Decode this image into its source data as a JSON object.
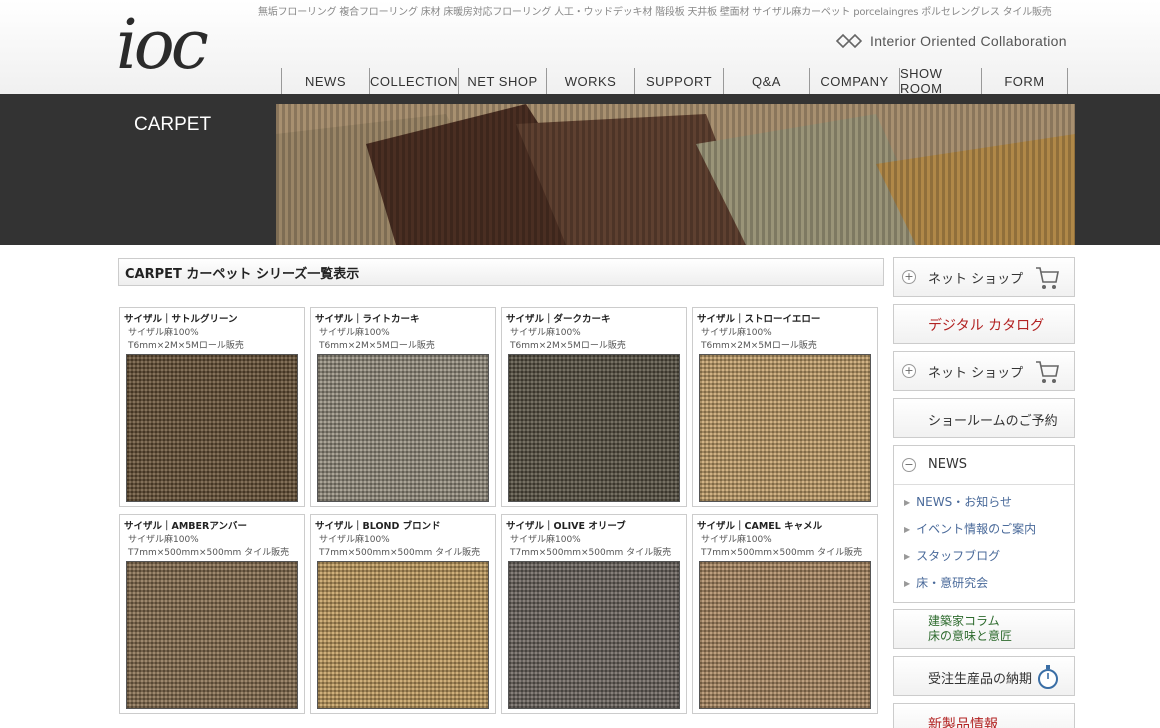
{
  "header": {
    "logo": "ioc",
    "keywords": "無垢フローリング 複合フローリング 床材 床暖房対応フローリング 人工・ウッドデッキ材 階段板 天井板 壁面材 サイザル麻カーペット porcelaingres ポルセレングレス タイル販売",
    "tagline": "Interior Oriented Collaboration"
  },
  "nav": [
    {
      "label": "NEWS",
      "w": 88
    },
    {
      "label": "COLLECTION",
      "w": 89
    },
    {
      "label": "NET SHOP",
      "w": 88
    },
    {
      "label": "WORKS",
      "w": 88
    },
    {
      "label": "SUPPORT",
      "w": 89
    },
    {
      "label": "Q&A",
      "w": 86
    },
    {
      "label": "COMPANY",
      "w": 90
    },
    {
      "label": "SHOW ROOM",
      "w": 82
    },
    {
      "label": "FORM",
      "w": 87
    }
  ],
  "banner": {
    "title": "CARPET"
  },
  "section_title": "CARPET カーペット シリーズ一覧表示",
  "products": [
    {
      "title": "サイザル｜サトルグリーン",
      "material": "サイザル麻100%",
      "spec": "T6mm×2M×5Mロール販売",
      "color": "#6b5438"
    },
    {
      "title": "サイザル｜ライトカーキ",
      "material": "サイザル麻100%",
      "spec": "T6mm×2M×5Mロール販売",
      "color": "#9a9282"
    },
    {
      "title": "サイザル｜ダークカーキ",
      "material": "サイザル麻100%",
      "spec": "T6mm×2M×5Mロール販売",
      "color": "#5a5444"
    },
    {
      "title": "サイザル｜ストローイエロー",
      "material": "サイザル麻100%",
      "spec": "T6mm×2M×5Mロール販売",
      "color": "#c8a46c"
    },
    {
      "title": "サイザル｜AMBERアンバー",
      "material": "サイザル麻100%",
      "spec": "T7mm×500mm×500mm タイル販売",
      "color": "#8a7050"
    },
    {
      "title": "サイザル｜BLOND ブロンド",
      "material": "サイザル麻100%",
      "spec": "T7mm×500mm×500mm タイル販売",
      "color": "#c6a060"
    },
    {
      "title": "サイザル｜OLIVE オリーブ",
      "material": "サイザル麻100%",
      "spec": "T7mm×500mm×500mm タイル販売",
      "color": "#6e6660"
    },
    {
      "title": "サイザル｜CAMEL キャメル",
      "material": "サイザル麻100%",
      "spec": "T7mm×500mm×500mm タイル販売",
      "color": "#b08c64"
    }
  ],
  "sidebar": {
    "net_shop_1": "ネット ショップ",
    "digital_catalog": "デジタル カタログ",
    "net_shop_2": "ネット ショップ",
    "showroom": "ショールームのご予約",
    "news_header": "NEWS",
    "news_links": [
      "NEWS・お知らせ",
      "イベント情報のご案内",
      "スタッフブログ",
      "床・意研究会"
    ],
    "column_line1": "建築家コラム",
    "column_line2": "床の意味と意匠",
    "lead_time": "受注生産品の納期",
    "new_products": "新製品情報",
    "digital_catalog_color": "#b22222",
    "column_color": "#2e6b2e"
  }
}
